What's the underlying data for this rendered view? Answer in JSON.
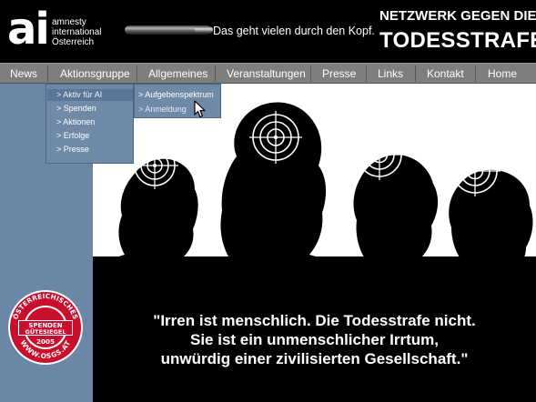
{
  "header": {
    "logo_mark": "ai",
    "logo_lines": [
      "amnesty",
      "international",
      "Österreich"
    ],
    "tagline": "Das geht vielen durch den Kopf.",
    "network_line1": "NETZWERK GEGEN DIE",
    "network_line2": "TODESSTRAFE"
  },
  "nav": {
    "items": [
      {
        "label": "News"
      },
      {
        "label": "Aktionsgruppe"
      },
      {
        "label": "Allgemeines"
      },
      {
        "label": "Veranstaltungen"
      },
      {
        "label": "Presse"
      },
      {
        "label": "Links"
      },
      {
        "label": "Kontakt"
      },
      {
        "label": "Home"
      }
    ]
  },
  "dropdown": {
    "items": [
      {
        "label": "> Aktiv für AI"
      },
      {
        "label": "> Spenden"
      },
      {
        "label": "> Aktionen"
      },
      {
        "label": "> Erfolge"
      },
      {
        "label": "> Presse"
      }
    ],
    "submenu": [
      {
        "label": "> Aufgebenspektrum"
      },
      {
        "label": "> Anmeldung"
      }
    ]
  },
  "quote": {
    "line1": "\"Irren ist menschlich. Die Todesstrafe nicht.",
    "line2": "Sie ist ein unmenschlicher Irrtum,",
    "line3": "unwürdig einer zivilisierten Gesellschaft.\""
  },
  "seal": {
    "top_text": "ÖSTERREICHISCHES",
    "ribbon_line1": "SPENDEN",
    "ribbon_line2": "GÜTESIEGEL",
    "year": "2005",
    "bottom_text": "WWW.OSGS.AT"
  },
  "colors": {
    "nav_bg": "#7e7e7e",
    "strip_blue": "#6a87a6",
    "dropdown_blue": "#6f8aa7",
    "seal_red": "#c8102e"
  },
  "icons": [
    "bullet-icon",
    "crosshair-target-icon",
    "mouse-pointer-icon"
  ]
}
